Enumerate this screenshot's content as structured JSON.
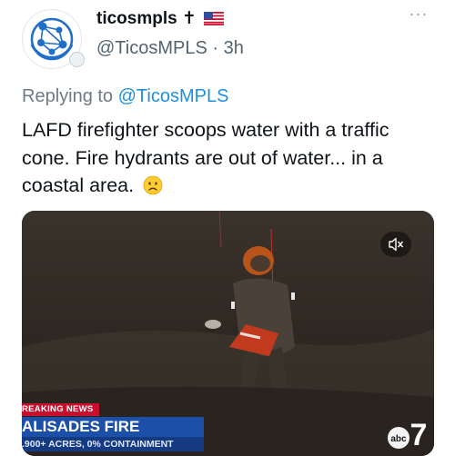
{
  "tweet": {
    "display_name": "ticosmpls",
    "name_suffix": "✝",
    "handle": "@TicosMPLS",
    "separator": "·",
    "time": "3h",
    "reply_prefix": "Replying to",
    "reply_mention": "@TicosMPLS",
    "text": "LAFD firefighter scoops water with a traffic cone. Fire hydrants are out of water... in a coastal area.",
    "more_label": "···"
  },
  "media": {
    "breaking_label": "REAKING NEWS",
    "headline": "ALISADES FIRE",
    "subline": ".900+ ACRES, 0% CONTAINMENT",
    "station_logo_text": "abc",
    "channel_number": "7",
    "mute_icon": "volume-off-icon"
  },
  "colors": {
    "link": "#1d8fe1",
    "breaking_red": "#c8102e",
    "banner_blue": "#1b4fa8"
  }
}
